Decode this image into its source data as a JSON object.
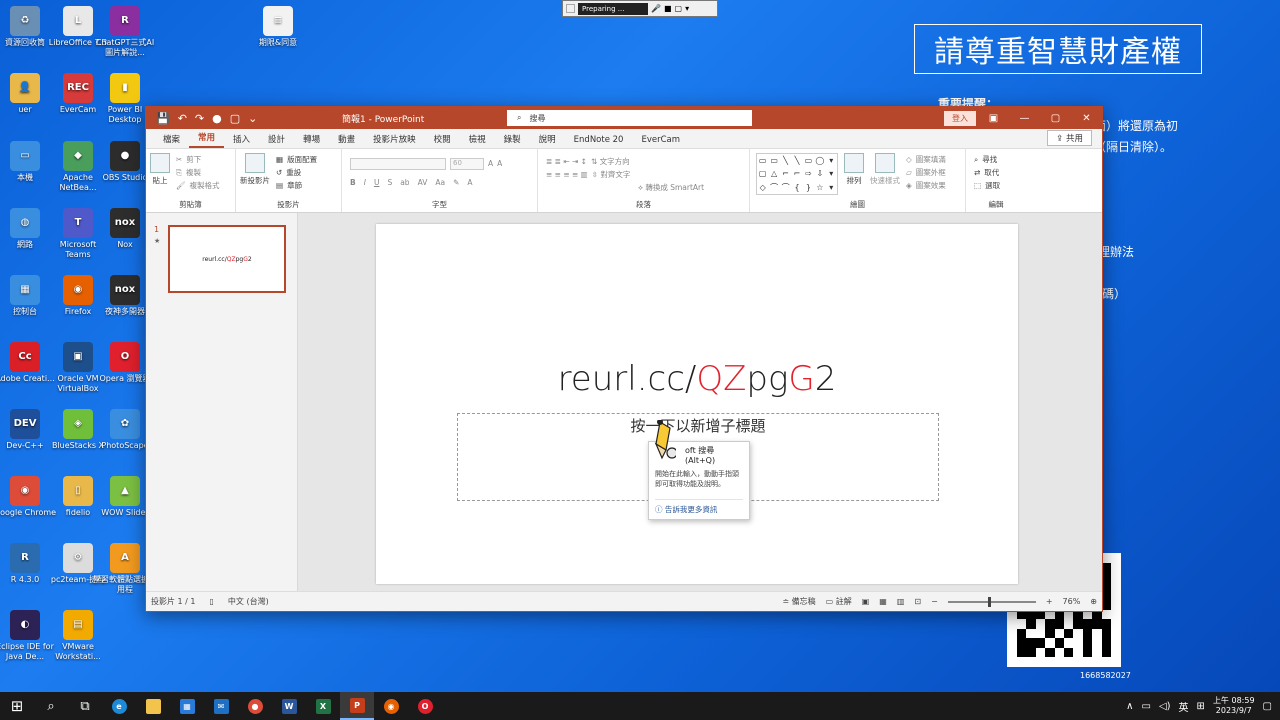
{
  "recorder": {
    "status": "Preparing ..."
  },
  "desktop": {
    "icons": [
      {
        "label": "資源回收筒",
        "color": "#6a8fb5",
        "glyph": "♻"
      },
      {
        "label": "LibreOffice 7.3",
        "color": "#e8e8e8",
        "glyph": "L"
      },
      {
        "label": "ChatGPT三式AI圖片解說...",
        "color": "#8b2fa0",
        "glyph": "R"
      },
      {
        "label": "期限&同意",
        "color": "#f2f2f2",
        "glyph": "≡"
      },
      {
        "label": "uer",
        "color": "#e8b84a",
        "glyph": "👤"
      },
      {
        "label": "EverCam",
        "color": "#d63a3a",
        "glyph": "REC"
      },
      {
        "label": "Power BI Desktop",
        "color": "#f2c811",
        "glyph": "▮"
      },
      {
        "label": "本機",
        "color": "#3a8ee0",
        "glyph": "▭"
      },
      {
        "label": "Apache NetBea...",
        "color": "#4a9e5c",
        "glyph": "◆"
      },
      {
        "label": "OBS Studio",
        "color": "#2c2c2c",
        "glyph": "●"
      },
      {
        "label": "網路",
        "color": "#3a8ee0",
        "glyph": "◍"
      },
      {
        "label": "Microsoft Teams",
        "color": "#5059c9",
        "glyph": "T"
      },
      {
        "label": "Nox",
        "color": "#2d2d2d",
        "glyph": "nox"
      },
      {
        "label": "控制台",
        "color": "#3a8ee0",
        "glyph": "▦"
      },
      {
        "label": "Firefox",
        "color": "#e66000",
        "glyph": "◉"
      },
      {
        "label": "夜神多開器",
        "color": "#2d2d2d",
        "glyph": "nox"
      },
      {
        "label": "Adobe Creati...",
        "color": "#da1f26",
        "glyph": "Cc"
      },
      {
        "label": "Oracle VM VirtualBox",
        "color": "#1c4f8c",
        "glyph": "▣"
      },
      {
        "label": "Opera 瀏覽器",
        "color": "#e0202d",
        "glyph": "O"
      },
      {
        "label": "Dev-C++",
        "color": "#1f4f9a",
        "glyph": "DEV"
      },
      {
        "label": "BlueStacks X",
        "color": "#6fbf3a",
        "glyph": "◈"
      },
      {
        "label": "PhotoScape",
        "color": "#3a8ee0",
        "glyph": "✿"
      },
      {
        "label": "Google Chrome",
        "color": "#dd4b39",
        "glyph": "◉"
      },
      {
        "label": "fidelio",
        "color": "#e8b84a",
        "glyph": "▯"
      },
      {
        "label": "WOW Slider",
        "color": "#7bc043",
        "glyph": "▲"
      },
      {
        "label": "R 4.3.0",
        "color": "#2b6cb0",
        "glyph": "R"
      },
      {
        "label": "pc2team-捷徑",
        "color": "#dcdcdc",
        "glyph": "⚙"
      },
      {
        "label": "學習軟體點選擴展用程",
        "color": "#f29a1f",
        "glyph": "A"
      },
      {
        "label": "Eclipse IDE for Java De...",
        "color": "#2c2255",
        "glyph": "◐"
      },
      {
        "label": "VMware Workstati...",
        "color": "#f2a900",
        "glyph": "▤"
      }
    ],
    "ip_banner": "請尊重智慧財產權",
    "notice_title": "重要提醒：",
    "notice_lines": [
      "面）將還原為初",
      "（隔日清除）。",
      "理辦法",
      "密碼）"
    ],
    "qr_id": "1668582027"
  },
  "ppt": {
    "quick_access": [
      "💾",
      "↶",
      "↷",
      "●",
      "▢",
      "⌄"
    ],
    "doc_title": "簡報1 - PowerPoint",
    "search_placeholder": "搜尋",
    "signin": "登入",
    "tabs": [
      "檔案",
      "常用",
      "插入",
      "設計",
      "轉場",
      "動畫",
      "投影片放映",
      "校閱",
      "檢視",
      "錄製",
      "說明",
      "EndNote 20",
      "EverCam"
    ],
    "share": "共用",
    "ribbon": {
      "clipboard": {
        "name": "剪貼簿",
        "paste": "貼上",
        "cut": "剪下",
        "copy": "複製",
        "format_painter": "複製格式"
      },
      "slides": {
        "name": "投影片",
        "new_slide": "新投影片",
        "layout": "版面配置",
        "reset": "重設",
        "section": "章節"
      },
      "font": {
        "name": "字型",
        "size": "60"
      },
      "paragraph": {
        "name": "段落",
        "text_dir": "文字方向",
        "align_text": "對齊文字",
        "smartart": "轉換成 SmartArt"
      },
      "drawing": {
        "name": "繪圖",
        "arrange": "排列",
        "quick_styles": "快速樣式",
        "fill": "圖案填滿",
        "outline": "圖案外框",
        "effects": "圖案效果"
      },
      "editing": {
        "name": "編輯",
        "find": "尋找",
        "replace": "取代",
        "select": "選取"
      }
    },
    "thumb": {
      "number": "1",
      "star": "★"
    },
    "slide": {
      "title_parts": [
        {
          "text": "reurl.cc/",
          "red": false
        },
        {
          "text": "QZ",
          "red": true
        },
        {
          "text": "pg",
          "red": false
        },
        {
          "text": "G",
          "red": true
        },
        {
          "text": "2",
          "red": false
        }
      ],
      "subtitle": "按一下以新增子標題"
    },
    "tooltip": {
      "title": "oft 搜尋 (Alt+Q)",
      "body": "開始在此輸入，動動手指頭即可取得功能及說明。",
      "link": "告訴我更多資訊"
    },
    "status": {
      "slide_of": "投影片 1 / 1",
      "language": "中文 (台灣)",
      "notes": "備忘稿",
      "comments": "註解",
      "zoom": "76%"
    }
  },
  "taskbar": {
    "ime": "英",
    "time": "上午 08:59",
    "date": "2023/9/7"
  }
}
